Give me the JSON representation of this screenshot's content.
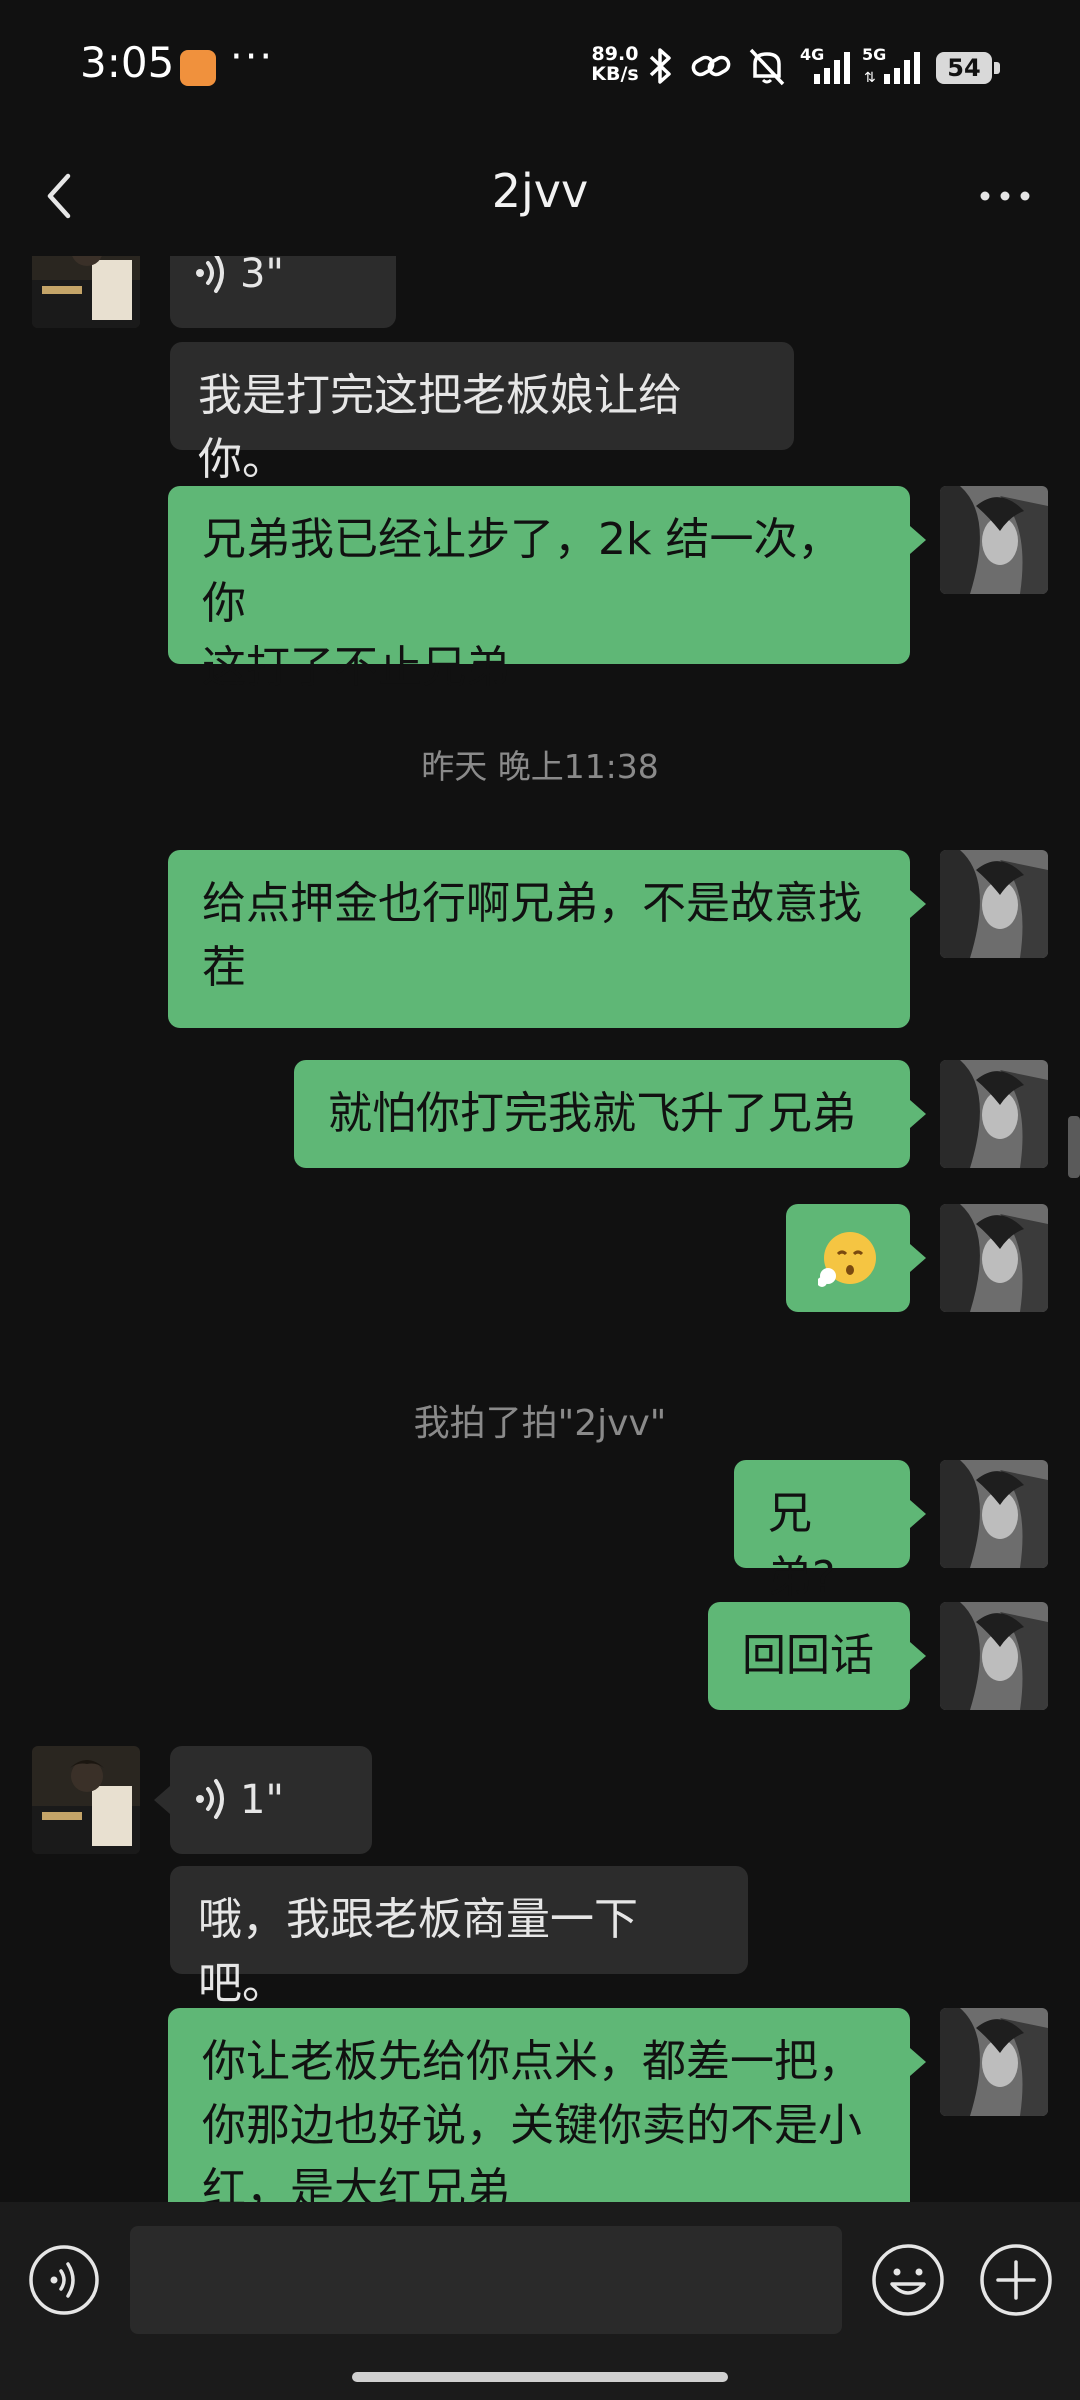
{
  "status_bar": {
    "time": "3:05",
    "net_speed_value": "89.0",
    "net_speed_unit": "KB/s",
    "signal_4g": "4G",
    "signal_5g": "5G",
    "battery": "54",
    "icons": [
      "app-notification-icon",
      "more-dots-icon",
      "bluetooth-icon",
      "link-icon",
      "mute-icon",
      "signal-icon",
      "battery-icon"
    ]
  },
  "header": {
    "title": "2jvv"
  },
  "messages": {
    "m0_voice": "3\"",
    "m1_text": "我是打完这把老板娘让给你。",
    "m2_text_line1": "兄弟我已经让步了，2k 结一次，你",
    "m2_text_line2": "这打了不止兄弟",
    "sys_time": "昨天 晚上11:38",
    "m3_text_line1": "给点押金也行啊兄弟，不是故意找",
    "m3_text_line2": "茬",
    "m4_text": "就怕你打完我就飞升了兄弟",
    "m5_emoji": "😮‍💨",
    "sys_pat": "我拍了拍\"2jvv\"",
    "m6_text": "兄弟?",
    "m7_text": "回回话",
    "m8_voice": "1\"",
    "m9_text": "哦，我跟老板商量一下吧。",
    "m10_line1": "你让老板先给你点米，都差一把，",
    "m10_line2": "你那边也好说，关键你卖的不是小",
    "m10_line3": "红，是大红兄弟"
  },
  "colors": {
    "background": "#111111",
    "incoming_bubble": "#2c2c2c",
    "outgoing_bubble": "#5fb776",
    "system_text": "#8a8a8a"
  }
}
